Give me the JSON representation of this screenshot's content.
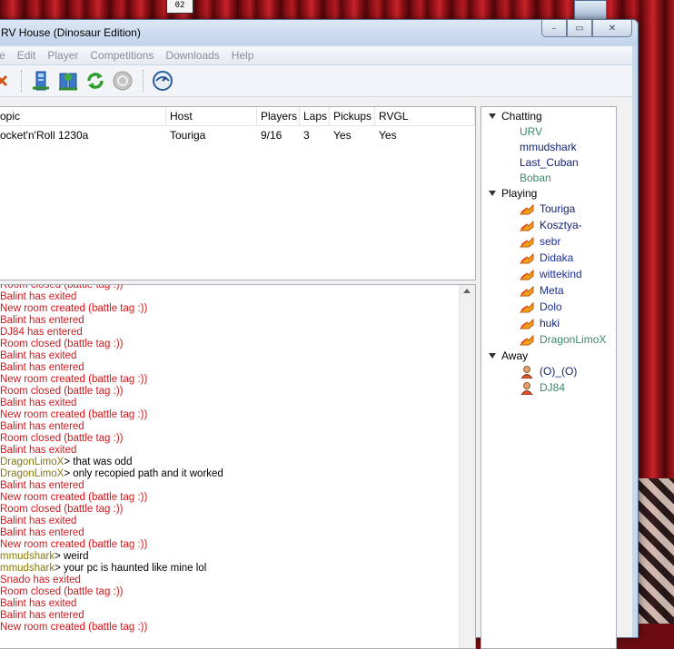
{
  "window": {
    "title": "RV House (Dinosaur Edition)",
    "controls": {
      "minimize": "–",
      "maximize": "▭",
      "close": "✕"
    }
  },
  "desktop": {
    "top_icon_label": "02"
  },
  "menu": [
    "e",
    "Edit",
    "Player",
    "Competitions",
    "Downloads",
    "Help"
  ],
  "toolbar": {
    "buttons": [
      "close-game-icon",
      "host-icon",
      "join-icon",
      "refresh-icon",
      "disconnect-icon",
      "settings-icon"
    ]
  },
  "games_table": {
    "columns": [
      "opic",
      "Host",
      "Players",
      "Laps",
      "Pickups",
      "RVGL"
    ],
    "rows": [
      [
        "ocket'n'Roll 1230a",
        "Touriga",
        "9/16",
        "3",
        "Yes",
        "Yes"
      ]
    ]
  },
  "chat_log": [
    {
      "type": "system",
      "text": "Room closed (battle tag :))"
    },
    {
      "type": "system",
      "text": "Balint has exited"
    },
    {
      "type": "system",
      "text": "New room created (battle tag :))"
    },
    {
      "type": "system",
      "text": "Balint has entered"
    },
    {
      "type": "system",
      "text": "DJ84 has entered"
    },
    {
      "type": "system",
      "text": "Room closed (battle tag :))"
    },
    {
      "type": "system",
      "text": "Balint has exited"
    },
    {
      "type": "system",
      "text": "Balint has entered"
    },
    {
      "type": "system",
      "text": "New room created (battle tag :))"
    },
    {
      "type": "system",
      "text": "Room closed (battle tag :))"
    },
    {
      "type": "system",
      "text": "Balint has exited"
    },
    {
      "type": "system",
      "text": "New room created (battle tag :))"
    },
    {
      "type": "system",
      "text": "Balint has entered"
    },
    {
      "type": "system",
      "text": "Room closed (battle tag :))"
    },
    {
      "type": "system",
      "text": "Balint has exited"
    },
    {
      "type": "chat",
      "nick": "DragonLimoX",
      "text": "that was odd"
    },
    {
      "type": "chat",
      "nick": "DragonLimoX",
      "text": "only recopied path and it worked"
    },
    {
      "type": "system",
      "text": "Balint has entered"
    },
    {
      "type": "system",
      "text": "New room created (battle tag :))"
    },
    {
      "type": "system",
      "text": "Room closed (battle tag :))"
    },
    {
      "type": "system",
      "text": "Balint has exited"
    },
    {
      "type": "system",
      "text": "Balint has entered"
    },
    {
      "type": "system",
      "text": "New room created (battle tag :))"
    },
    {
      "type": "chat",
      "nick": "mmudshark",
      "text": "weird"
    },
    {
      "type": "chat",
      "nick": "mmudshark",
      "text": "your pc is haunted like mine lol"
    },
    {
      "type": "system",
      "text": "Snado has exited"
    },
    {
      "type": "system",
      "text": "Room closed (battle tag :))"
    },
    {
      "type": "system",
      "text": "Balint has exited"
    },
    {
      "type": "system",
      "text": "Balint has entered"
    },
    {
      "type": "system",
      "text": "New room created (battle tag :))"
    }
  ],
  "chat_prompt": ">",
  "users": {
    "chatting": {
      "label": "Chatting",
      "members": [
        {
          "name": "URV",
          "color": "#3a8a6a"
        },
        {
          "name": "mmudshark",
          "color": "#0d1f75"
        },
        {
          "name": "Last_Cuban",
          "color": "#0d1f75"
        },
        {
          "name": "Boban",
          "color": "#3a8a6a"
        }
      ]
    },
    "playing": {
      "label": "Playing",
      "members": [
        {
          "name": "Touriga",
          "color": "#0d1f75"
        },
        {
          "name": "Kosztya-",
          "color": "#0d1f75"
        },
        {
          "name": "sebr",
          "color": "#1a2fa0"
        },
        {
          "name": "Didaka",
          "color": "#1a2fa0"
        },
        {
          "name": "wittekind",
          "color": "#1a2fa0"
        },
        {
          "name": "Meta",
          "color": "#1a2fa0"
        },
        {
          "name": "Dolo",
          "color": "#1a2fa0"
        },
        {
          "name": "huki",
          "color": "#0d1f75"
        },
        {
          "name": "DragonLimoX",
          "color": "#3a8a6a"
        }
      ]
    },
    "away": {
      "label": "Away",
      "members": [
        {
          "name": "(O)_(O)",
          "color": "#0d1f75"
        },
        {
          "name": "DJ84",
          "color": "#3a8a6a"
        }
      ]
    }
  },
  "colors": {
    "system_message": "#d3161b",
    "nick": "#877a0a",
    "menu_disabled": "#8a8f96"
  }
}
